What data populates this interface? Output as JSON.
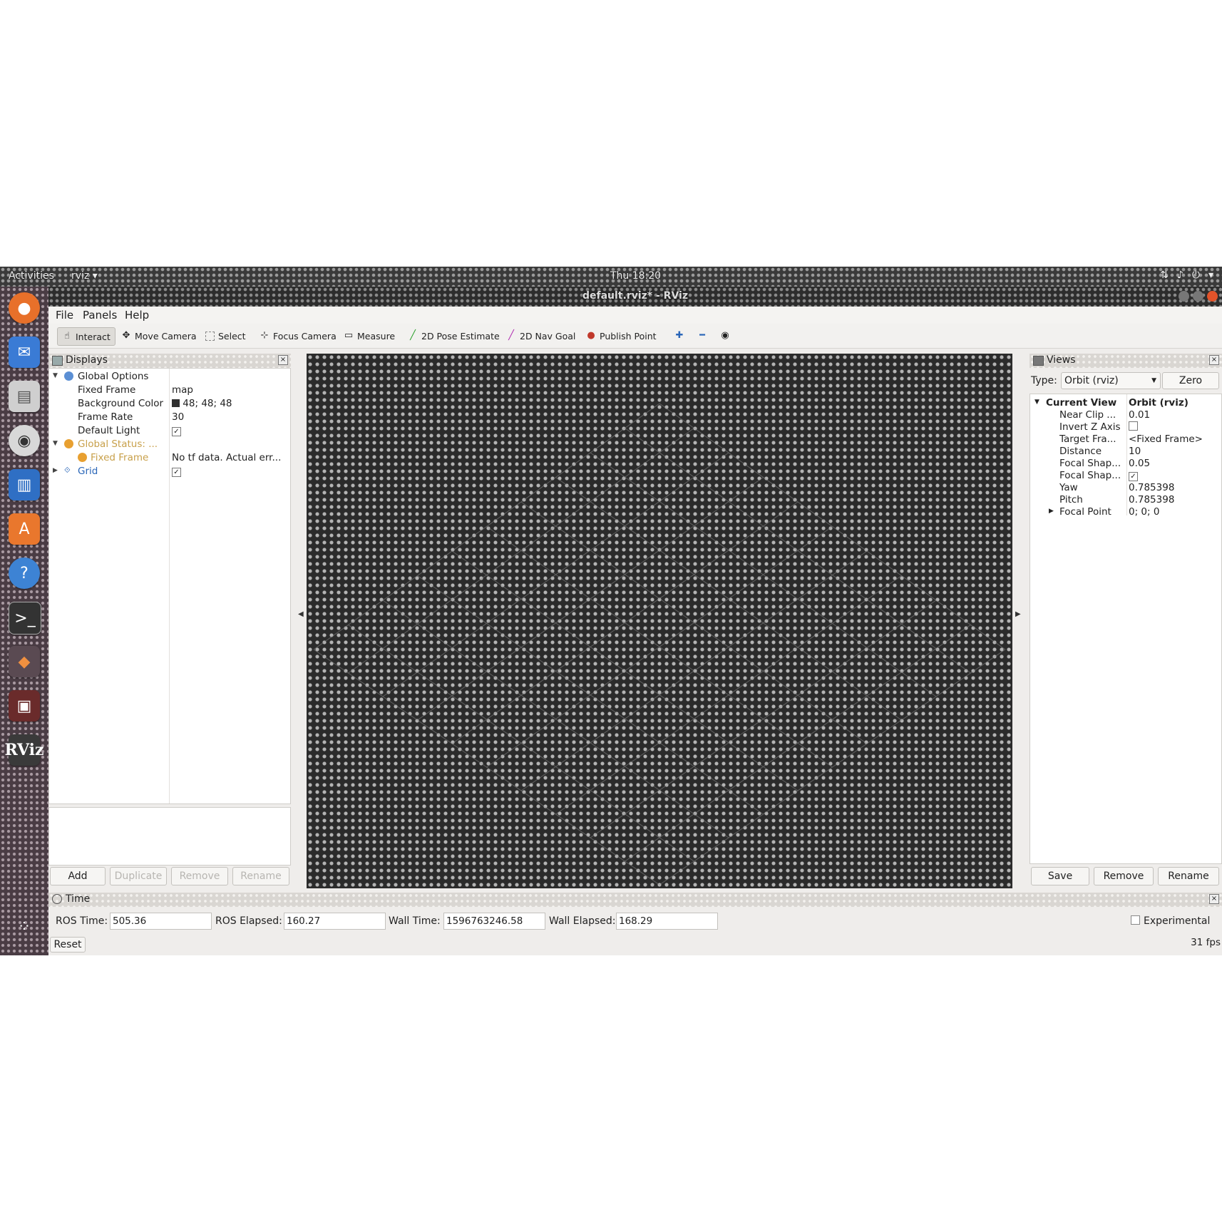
{
  "topbar": {
    "activities": "Activities",
    "app_menu": "rviz ▾",
    "clock": "Thu 18:20"
  },
  "window": {
    "title": "default.rviz* - RViz"
  },
  "menu": {
    "file": "File",
    "panels": "Panels",
    "help": "Help"
  },
  "toolbar": {
    "interact": "Interact",
    "move_camera": "Move Camera",
    "select": "Select",
    "focus_camera": "Focus Camera",
    "measure": "Measure",
    "pose_estimate": "2D Pose Estimate",
    "nav_goal": "2D Nav Goal",
    "publish_point": "Publish Point"
  },
  "displays": {
    "title": "Displays",
    "global_options": "Global Options",
    "fixed_frame_label": "Fixed Frame",
    "fixed_frame_value": "map",
    "background_color_label": "Background Color",
    "background_color_value": "48; 48; 48",
    "frame_rate_label": "Frame Rate",
    "frame_rate_value": "30",
    "default_light_label": "Default Light",
    "default_light_checked": "✓",
    "global_status": "Global Status: ...",
    "status_fixed_frame_label": "Fixed Frame",
    "status_fixed_frame_value": "No tf data.  Actual err...",
    "grid_label": "Grid",
    "grid_checked": "✓",
    "buttons": {
      "add": "Add",
      "duplicate": "Duplicate",
      "remove": "Remove",
      "rename": "Rename"
    },
    "colors": {
      "warning": "#c8a04a",
      "grid": "#2a66b8",
      "bg_swatch": "#303030"
    }
  },
  "views": {
    "title": "Views",
    "type_label": "Type:",
    "type_value": "Orbit (rviz)",
    "zero": "Zero",
    "current_view_label": "Current View",
    "current_view_value": "Orbit (rviz)",
    "rows": [
      {
        "label": "Near Clip ...",
        "value": "0.01"
      },
      {
        "label": "Invert Z Axis",
        "value": ""
      },
      {
        "label": "Target Fra...",
        "value": "<Fixed Frame>"
      },
      {
        "label": "Distance",
        "value": "10"
      },
      {
        "label": "Focal Shap...",
        "value": "0.05"
      },
      {
        "label": "Focal Shap...",
        "value": "✓"
      },
      {
        "label": "Yaw",
        "value": "0.785398"
      },
      {
        "label": "Pitch",
        "value": "0.785398"
      },
      {
        "label": "Focal Point",
        "value": "0; 0; 0"
      }
    ],
    "buttons": {
      "save": "Save",
      "remove": "Remove",
      "rename": "Rename"
    }
  },
  "time": {
    "title": "Time",
    "ros_time_label": "ROS Time:",
    "ros_time_value": "505.36",
    "ros_elapsed_label": "ROS Elapsed:",
    "ros_elapsed_value": "160.27",
    "wall_time_label": "Wall Time:",
    "wall_time_value": "1596763246.58",
    "wall_elapsed_label": "Wall Elapsed:",
    "wall_elapsed_value": "168.29",
    "experimental": "Experimental",
    "reset": "Reset",
    "fps": "31 fps"
  }
}
